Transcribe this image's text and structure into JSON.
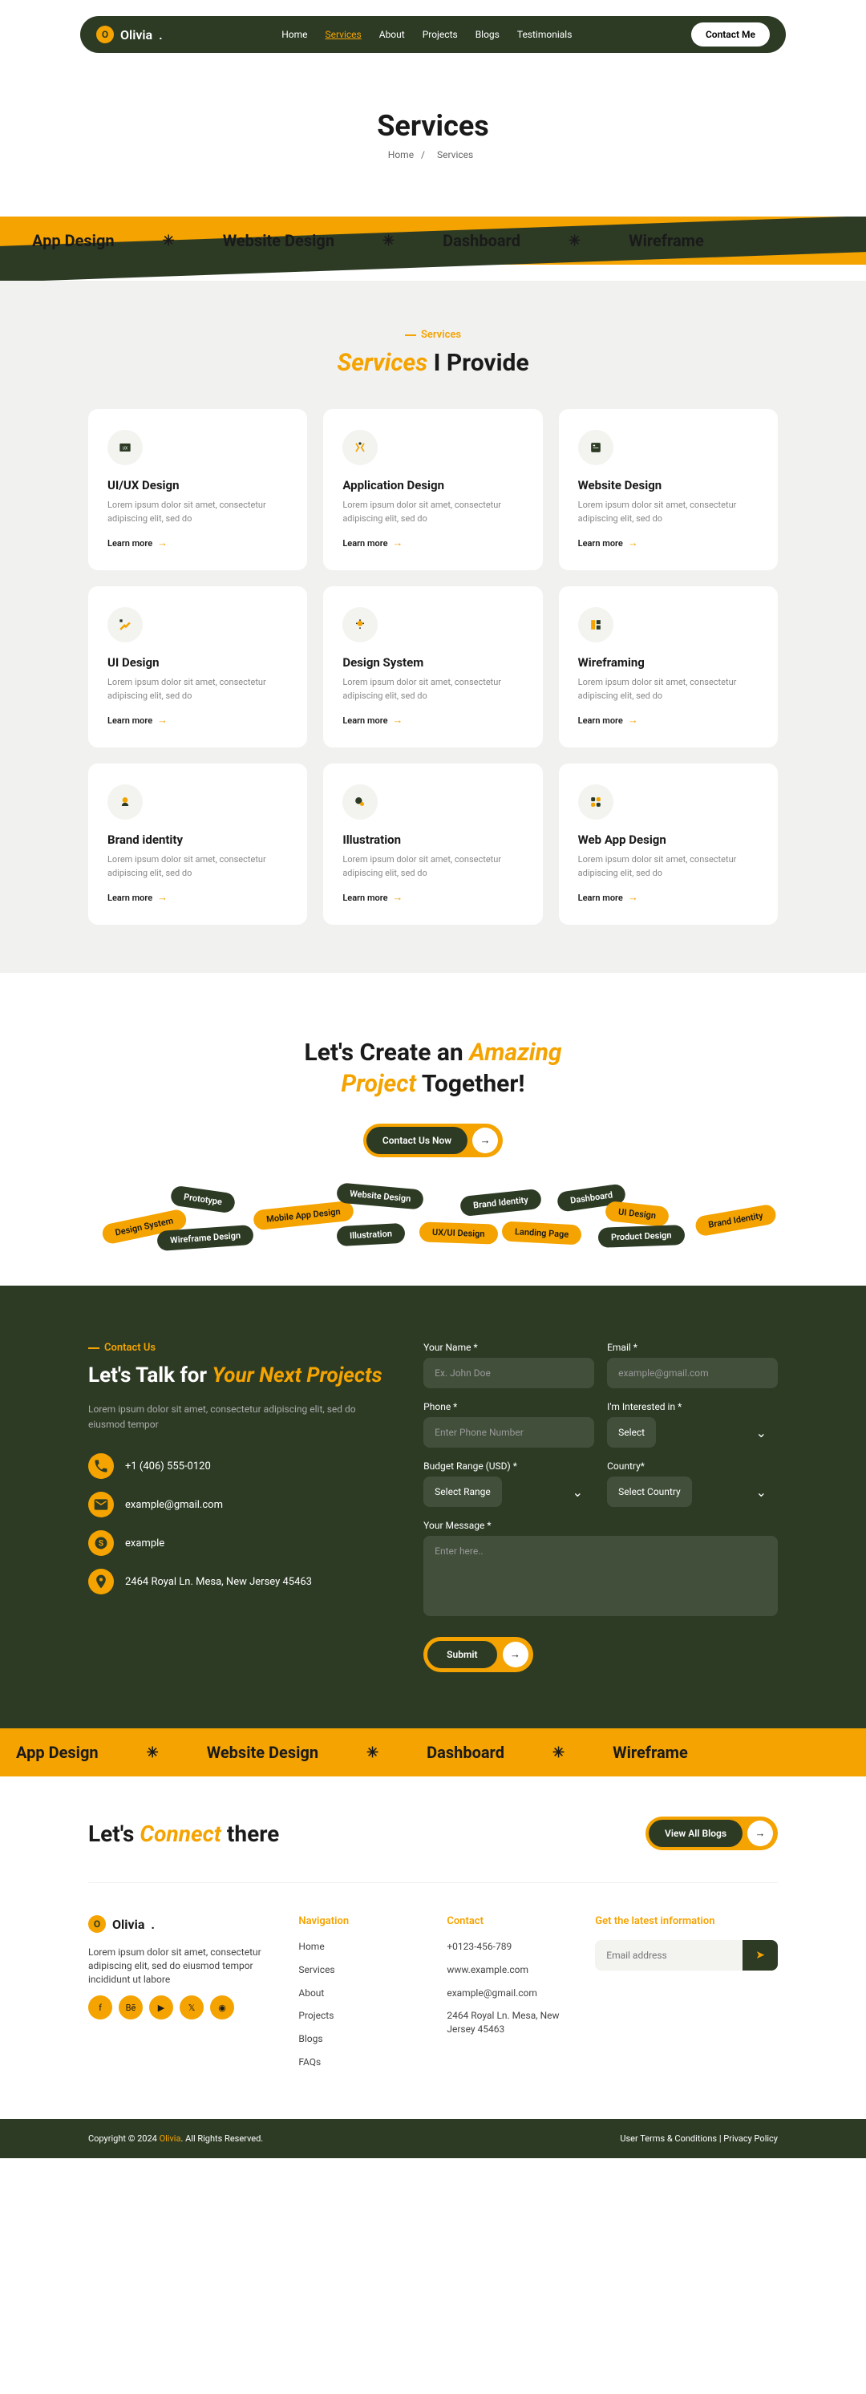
{
  "brand": "Olivia",
  "nav": {
    "items": [
      "Home",
      "Services",
      "About",
      "Projects",
      "Blogs",
      "Testimonials"
    ],
    "active": 1,
    "contact": "Contact Me"
  },
  "hero": {
    "title": "Services",
    "crumb_home": "Home",
    "crumb_sep": "/",
    "crumb_current": "Services"
  },
  "ribbon": [
    "App Design",
    "Website Design",
    "Dashboard",
    "Wireframe"
  ],
  "services": {
    "tag": "Services",
    "title_em": "Services",
    "title_rest": " I Provide",
    "learn": "Learn more",
    "lorem": "Lorem ipsum dolor sit amet, consectetur adipiscing elit, sed do",
    "items": [
      {
        "title": "UI/UX Design"
      },
      {
        "title": "Application Design"
      },
      {
        "title": "Website Design"
      },
      {
        "title": "UI Design"
      },
      {
        "title": "Design System"
      },
      {
        "title": "Wireframing"
      },
      {
        "title": "Brand identity"
      },
      {
        "title": "Illustration"
      },
      {
        "title": "Web App Design"
      }
    ]
  },
  "cta": {
    "line1_a": "Let's Create an ",
    "line1_em": "Amazing",
    "line2_em": "Project",
    "line2_rest": " Together!",
    "button": "Contact Us Now"
  },
  "pills": [
    "Design System",
    "Prototype",
    "Wireframe Design",
    "Mobile App Design",
    "Website Design",
    "Illustration",
    "UX/UI Design",
    "Brand Identity",
    "Landing Page",
    "Dashboard",
    "UI Design",
    "Product Design",
    "Brand Identity"
  ],
  "contact": {
    "tag": "Contact Us",
    "title_a": "Let's Talk for ",
    "title_em": "Your Next Projects",
    "desc": "Lorem ipsum dolor sit amet, consectetur adipiscing elit, sed do eiusmod tempor",
    "phone": "+1 (406) 555-0120",
    "email": "example@gmail.com",
    "skype": "example",
    "address": "2464 Royal Ln. Mesa, New Jersey 45463",
    "form": {
      "name_l": "Your Name *",
      "name_p": "Ex. John Doe",
      "email_l": "Email *",
      "email_p": "example@gmail.com",
      "phone_l": "Phone *",
      "phone_p": "Enter Phone Number",
      "interest_l": "I'm Interested in *",
      "interest_p": "Select",
      "budget_l": "Budget Range (USD) *",
      "budget_p": "Select Range",
      "country_l": "Country*",
      "country_p": "Select Country",
      "message_l": "Your Message *",
      "message_p": "Enter here..",
      "submit": "Submit"
    }
  },
  "connect": {
    "title_a": "Let's ",
    "title_em": "Connect",
    "title_b": " there",
    "button": "View All Blogs"
  },
  "footer": {
    "desc": "Lorem ipsum dolor sit amet, consectetur adipiscing elit, sed do eiusmod tempor incididunt ut labore",
    "nav_h": "Navigation",
    "nav_items": [
      "Home",
      "Services",
      "About",
      "Projects",
      "Blogs",
      "FAQs"
    ],
    "contact_h": "Contact",
    "contact_items": [
      "+0123-456-789",
      "www.example.com",
      "example@gmail.com",
      "2464 Royal Ln. Mesa, New Jersey 45463"
    ],
    "news_h": "Get the latest information",
    "news_p": "Email address"
  },
  "copyright": {
    "text_a": "Copyright © 2024 ",
    "brand": "Olivia",
    "text_b": ". All Rights Reserved.",
    "terms": "User Terms & Conditions",
    "sep": " | ",
    "privacy": "Privacy Policy"
  }
}
